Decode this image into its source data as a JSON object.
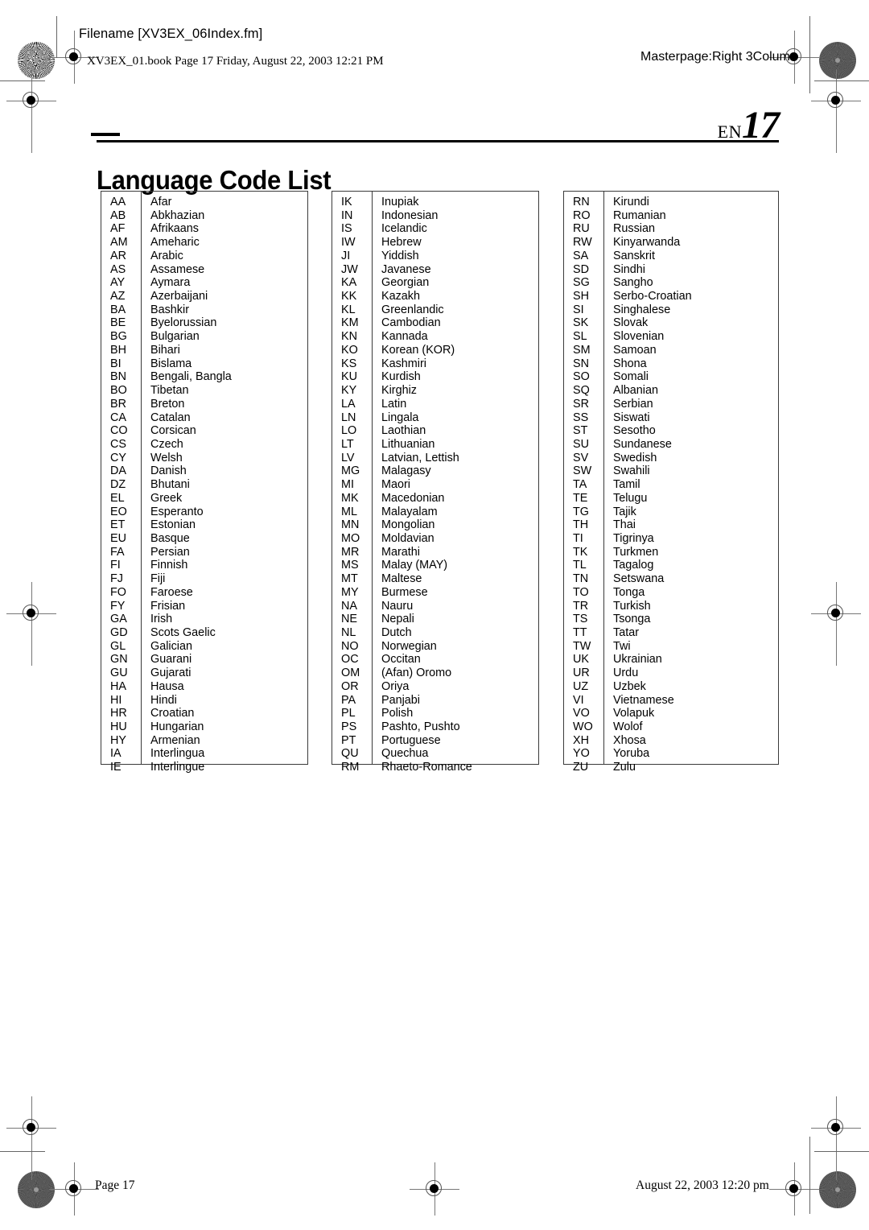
{
  "header": {
    "filename_label": "Filename [XV3EX_06Index.fm]",
    "book_line": "XV3EX_01.book  Page 17  Friday, August 22, 2003  12:21 PM",
    "masterpage": "Masterpage:Right 3Column"
  },
  "page_marker": {
    "locale": "EN",
    "number": "17"
  },
  "title": "Language Code List",
  "footer": {
    "page_label": "Page 17",
    "timestamp": "August 22, 2003 12:20 pm"
  },
  "tables": [
    {
      "id": "col-1",
      "rows": [
        {
          "code": "AA",
          "name": "Afar"
        },
        {
          "code": "AB",
          "name": "Abkhazian"
        },
        {
          "code": "AF",
          "name": "Afrikaans"
        },
        {
          "code": "AM",
          "name": "Ameharic"
        },
        {
          "code": "AR",
          "name": "Arabic"
        },
        {
          "code": "AS",
          "name": "Assamese"
        },
        {
          "code": "AY",
          "name": "Aymara"
        },
        {
          "code": "AZ",
          "name": "Azerbaijani"
        },
        {
          "code": "BA",
          "name": "Bashkir"
        },
        {
          "code": "BE",
          "name": "Byelorussian"
        },
        {
          "code": "BG",
          "name": "Bulgarian"
        },
        {
          "code": "BH",
          "name": "Bihari"
        },
        {
          "code": "BI",
          "name": "Bislama"
        },
        {
          "code": "BN",
          "name": "Bengali, Bangla"
        },
        {
          "code": "BO",
          "name": "Tibetan"
        },
        {
          "code": "BR",
          "name": "Breton"
        },
        {
          "code": "CA",
          "name": "Catalan"
        },
        {
          "code": "CO",
          "name": "Corsican"
        },
        {
          "code": "CS",
          "name": "Czech"
        },
        {
          "code": "CY",
          "name": "Welsh"
        },
        {
          "code": "DA",
          "name": "Danish"
        },
        {
          "code": "DZ",
          "name": "Bhutani"
        },
        {
          "code": "EL",
          "name": "Greek"
        },
        {
          "code": "EO",
          "name": "Esperanto"
        },
        {
          "code": "ET",
          "name": "Estonian"
        },
        {
          "code": "EU",
          "name": "Basque"
        },
        {
          "code": "FA",
          "name": "Persian"
        },
        {
          "code": "FI",
          "name": "Finnish"
        },
        {
          "code": "FJ",
          "name": "Fiji"
        },
        {
          "code": "FO",
          "name": "Faroese"
        },
        {
          "code": "FY",
          "name": "Frisian"
        },
        {
          "code": "GA",
          "name": "Irish"
        },
        {
          "code": "GD",
          "name": "Scots Gaelic"
        },
        {
          "code": "GL",
          "name": "Galician"
        },
        {
          "code": "GN",
          "name": "Guarani"
        },
        {
          "code": "GU",
          "name": "Gujarati"
        },
        {
          "code": "HA",
          "name": "Hausa"
        },
        {
          "code": "HI",
          "name": "Hindi"
        },
        {
          "code": "HR",
          "name": "Croatian"
        },
        {
          "code": "HU",
          "name": "Hungarian"
        },
        {
          "code": "HY",
          "name": "Armenian"
        },
        {
          "code": "IA",
          "name": "Interlingua"
        },
        {
          "code": "IE",
          "name": "Interlingue"
        }
      ]
    },
    {
      "id": "col-2",
      "rows": [
        {
          "code": "IK",
          "name": "Inupiak"
        },
        {
          "code": "IN",
          "name": "Indonesian"
        },
        {
          "code": "IS",
          "name": "Icelandic"
        },
        {
          "code": "IW",
          "name": "Hebrew"
        },
        {
          "code": "JI",
          "name": "Yiddish"
        },
        {
          "code": "JW",
          "name": "Javanese"
        },
        {
          "code": "KA",
          "name": "Georgian"
        },
        {
          "code": "KK",
          "name": "Kazakh"
        },
        {
          "code": "KL",
          "name": "Greenlandic"
        },
        {
          "code": "KM",
          "name": "Cambodian"
        },
        {
          "code": "KN",
          "name": "Kannada"
        },
        {
          "code": "KO",
          "name": "Korean (KOR)"
        },
        {
          "code": "KS",
          "name": "Kashmiri"
        },
        {
          "code": "KU",
          "name": "Kurdish"
        },
        {
          "code": "KY",
          "name": "Kirghiz"
        },
        {
          "code": "LA",
          "name": "Latin"
        },
        {
          "code": "LN",
          "name": "Lingala"
        },
        {
          "code": "LO",
          "name": "Laothian"
        },
        {
          "code": "LT",
          "name": "Lithuanian"
        },
        {
          "code": "LV",
          "name": "Latvian, Lettish"
        },
        {
          "code": "MG",
          "name": "Malagasy"
        },
        {
          "code": "MI",
          "name": "Maori"
        },
        {
          "code": "MK",
          "name": "Macedonian"
        },
        {
          "code": "ML",
          "name": "Malayalam"
        },
        {
          "code": "MN",
          "name": "Mongolian"
        },
        {
          "code": "MO",
          "name": "Moldavian"
        },
        {
          "code": "MR",
          "name": "Marathi"
        },
        {
          "code": "MS",
          "name": "Malay (MAY)"
        },
        {
          "code": "MT",
          "name": "Maltese"
        },
        {
          "code": "MY",
          "name": "Burmese"
        },
        {
          "code": "NA",
          "name": "Nauru"
        },
        {
          "code": "NE",
          "name": "Nepali"
        },
        {
          "code": "NL",
          "name": "Dutch"
        },
        {
          "code": "NO",
          "name": "Norwegian"
        },
        {
          "code": "OC",
          "name": "Occitan"
        },
        {
          "code": "OM",
          "name": "(Afan) Oromo"
        },
        {
          "code": "OR",
          "name": "Oriya"
        },
        {
          "code": "PA",
          "name": "Panjabi"
        },
        {
          "code": "PL",
          "name": "Polish"
        },
        {
          "code": "PS",
          "name": "Pashto, Pushto"
        },
        {
          "code": "PT",
          "name": "Portuguese"
        },
        {
          "code": "QU",
          "name": "Quechua"
        },
        {
          "code": "RM",
          "name": "Rhaeto-Romance"
        }
      ]
    },
    {
      "id": "col-3",
      "rows": [
        {
          "code": "RN",
          "name": "Kirundi"
        },
        {
          "code": "RO",
          "name": "Rumanian"
        },
        {
          "code": "RU",
          "name": "Russian"
        },
        {
          "code": "RW",
          "name": "Kinyarwanda"
        },
        {
          "code": "SA",
          "name": "Sanskrit"
        },
        {
          "code": "SD",
          "name": "Sindhi"
        },
        {
          "code": "SG",
          "name": "Sangho"
        },
        {
          "code": "SH",
          "name": "Serbo-Croatian"
        },
        {
          "code": "SI",
          "name": "Singhalese"
        },
        {
          "code": "SK",
          "name": "Slovak"
        },
        {
          "code": "SL",
          "name": "Slovenian"
        },
        {
          "code": "SM",
          "name": "Samoan"
        },
        {
          "code": "SN",
          "name": "Shona"
        },
        {
          "code": "SO",
          "name": "Somali"
        },
        {
          "code": "SQ",
          "name": "Albanian"
        },
        {
          "code": "SR",
          "name": "Serbian"
        },
        {
          "code": "SS",
          "name": "Siswati"
        },
        {
          "code": "ST",
          "name": "Sesotho"
        },
        {
          "code": "SU",
          "name": "Sundanese"
        },
        {
          "code": "SV",
          "name": "Swedish"
        },
        {
          "code": "SW",
          "name": "Swahili"
        },
        {
          "code": "TA",
          "name": "Tamil"
        },
        {
          "code": "TE",
          "name": "Telugu"
        },
        {
          "code": "TG",
          "name": "Tajik"
        },
        {
          "code": "TH",
          "name": "Thai"
        },
        {
          "code": "TI",
          "name": "Tigrinya"
        },
        {
          "code": "TK",
          "name": "Turkmen"
        },
        {
          "code": "TL",
          "name": "Tagalog"
        },
        {
          "code": "TN",
          "name": "Setswana"
        },
        {
          "code": "TO",
          "name": "Tonga"
        },
        {
          "code": "TR",
          "name": "Turkish"
        },
        {
          "code": "TS",
          "name": "Tsonga"
        },
        {
          "code": "TT",
          "name": "Tatar"
        },
        {
          "code": "TW",
          "name": "Twi"
        },
        {
          "code": "UK",
          "name": "Ukrainian"
        },
        {
          "code": "UR",
          "name": "Urdu"
        },
        {
          "code": "UZ",
          "name": "Uzbek"
        },
        {
          "code": "VI",
          "name": "Vietnamese"
        },
        {
          "code": "VO",
          "name": "Volapuk"
        },
        {
          "code": "WO",
          "name": "Wolof"
        },
        {
          "code": "XH",
          "name": "Xhosa"
        },
        {
          "code": "YO",
          "name": "Yoruba"
        },
        {
          "code": "ZU",
          "name": "Zulu"
        }
      ]
    }
  ]
}
